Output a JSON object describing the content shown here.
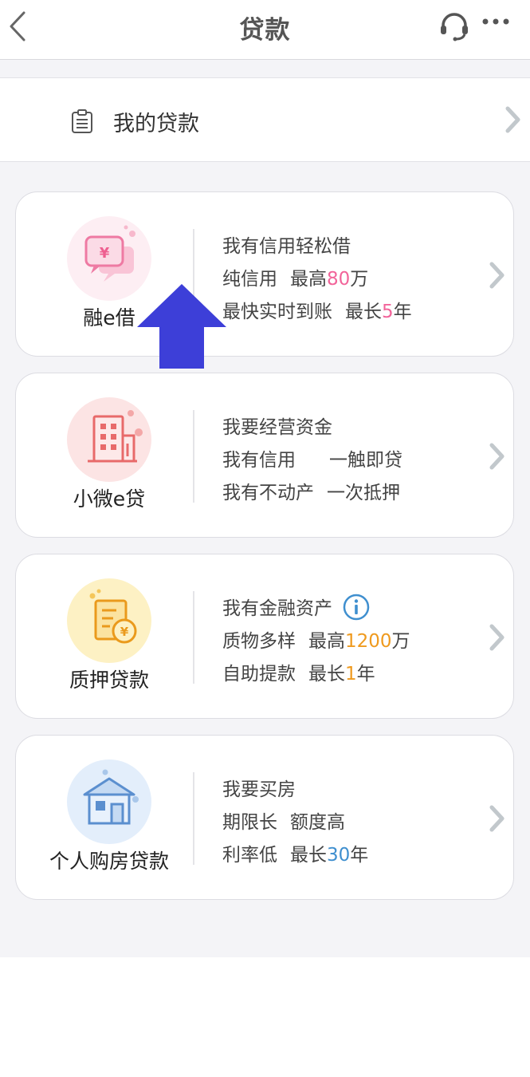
{
  "header": {
    "title": "贷款"
  },
  "my_loan": {
    "label": "我的贷款"
  },
  "colors": {
    "pink": "#f2649a",
    "orange": "#ef9a1e",
    "blue": "#3f8fcf",
    "arrow": "#3d3fd8"
  },
  "cards": [
    {
      "name": "融e借",
      "icon": "chat-yuan-icon",
      "line1": "我有信用轻松借",
      "l2a": "纯信用",
      "l2b": "最高",
      "l2num": "80",
      "l2unit": "万",
      "l3a": "最快实时到账",
      "l3b": "最长",
      "l3num": "5",
      "l3unit": "年"
    },
    {
      "name": "小微e贷",
      "icon": "building-icon",
      "line1": "我要经营资金",
      "l2a": "我有信用",
      "l2b": "一触即贷",
      "l3a": "我有不动产",
      "l3b": "一次抵押"
    },
    {
      "name": "质押贷款",
      "icon": "document-yuan-icon",
      "line1": "我有金融资产",
      "l2a": "质物多样",
      "l2b": "最高",
      "l2num": "1200",
      "l2unit": "万",
      "l3a": "自助提款",
      "l3b": "最长",
      "l3num": "1",
      "l3unit": "年"
    },
    {
      "name": "个人购房贷款",
      "icon": "house-icon",
      "line1": "我要买房",
      "l2a": "期限长",
      "l2b": "额度高",
      "l3a": "利率低",
      "l3b": "最长",
      "l3num": "30",
      "l3unit": "年"
    }
  ]
}
